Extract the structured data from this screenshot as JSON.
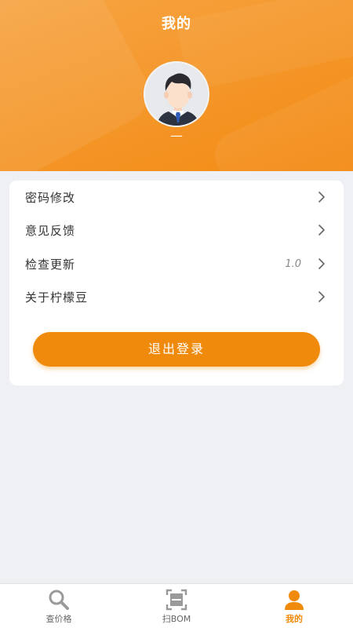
{
  "header": {
    "title": "我的",
    "username": "—"
  },
  "menu": {
    "items": [
      {
        "label": "密码修改",
        "value": ""
      },
      {
        "label": "意见反馈",
        "value": ""
      },
      {
        "label": "检查更新",
        "value": "1.0"
      },
      {
        "label": "关于柠檬豆",
        "value": ""
      }
    ],
    "logout_label": "退出登录"
  },
  "tabbar": {
    "tabs": [
      {
        "label": "查价格",
        "icon": "search-icon"
      },
      {
        "label": "扫BOM",
        "icon": "scan-icon"
      },
      {
        "label": "我的",
        "icon": "user-icon"
      }
    ],
    "active_index": 2
  },
  "colors": {
    "accent": "#f08a0c",
    "header_gradient_start": "#f7a544",
    "header_gradient_end": "#f38a12",
    "background": "#eef0f4",
    "inactive_icon": "#9a9a9a"
  }
}
